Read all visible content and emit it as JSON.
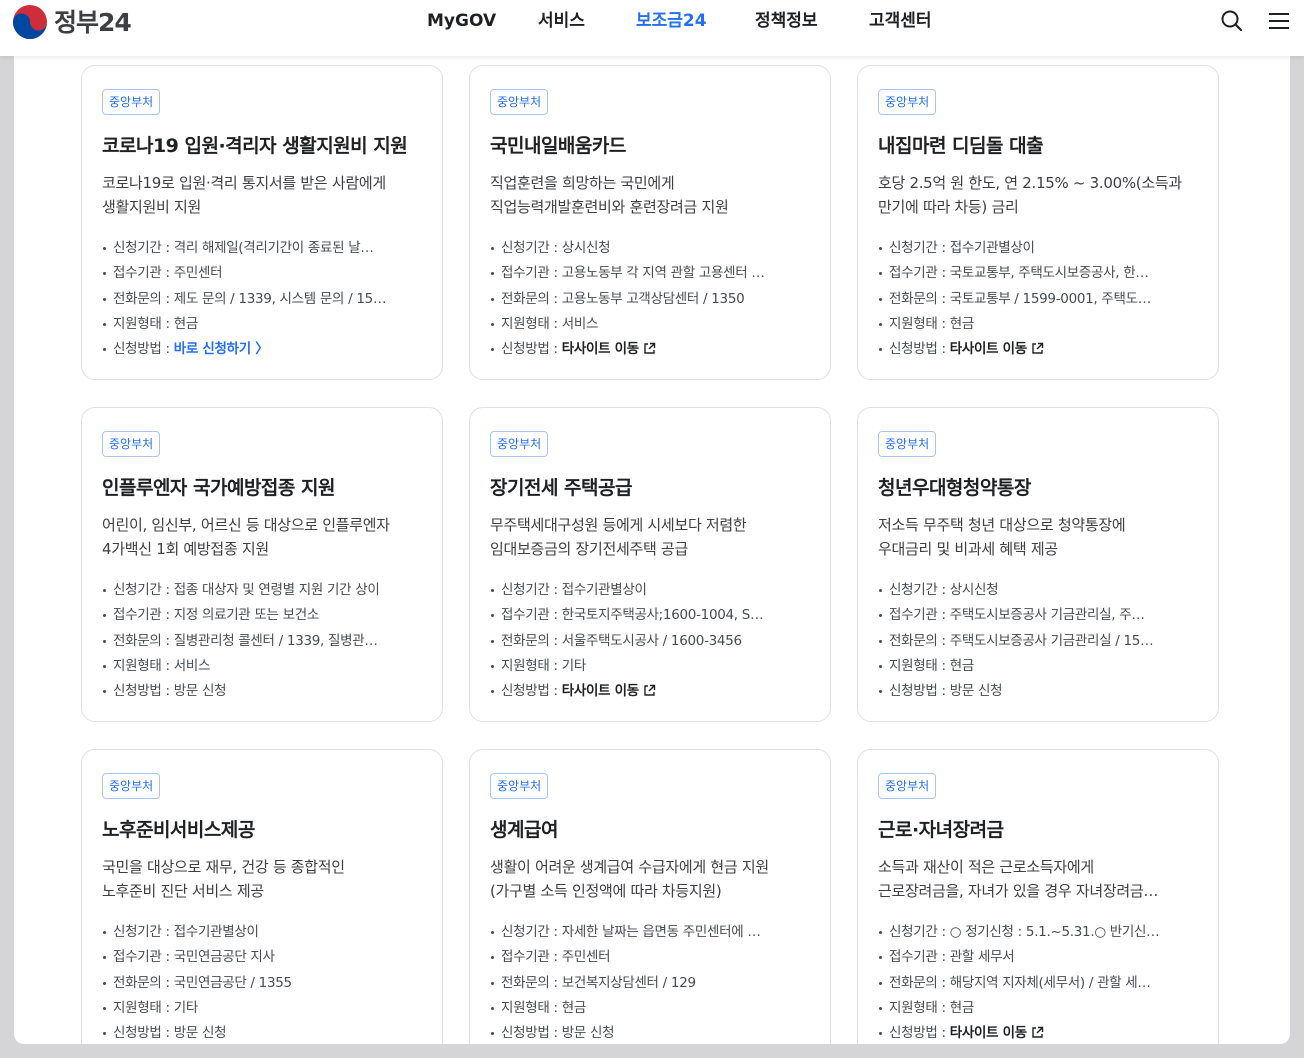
{
  "logo": {
    "text": "정부24"
  },
  "nav": {
    "items": [
      {
        "label": "MyGOV"
      },
      {
        "label": "서비스"
      },
      {
        "label": "보조금24"
      },
      {
        "label": "정책정보"
      },
      {
        "label": "고객센터"
      }
    ],
    "active": "보조금24"
  },
  "icons": {
    "search": "search-icon",
    "menu": "menu-icon",
    "external": "external-link-icon"
  },
  "colors": {
    "accent": "#256ef4",
    "badge_border": "#a9c4f3",
    "card_border": "#dfe1e6"
  },
  "labels": {
    "period": "신청기간 : ",
    "agency": "접수기관 : ",
    "phone": "전화문의 : ",
    "type": "지원형태 : ",
    "method": "신청방법 : "
  },
  "cards": [
    {
      "badge": "중앙부처",
      "title": "코로나19 입원·격리자 생활지원비 지원",
      "desc": [
        "코로나19로 입원·격리 통지서를 받은 사람에게",
        "생활지원비 지원"
      ],
      "period": "격리 해제일(격리기간이 종료된 날…",
      "agency": "주민센터",
      "phone": "제도 문의 / 1339, 시스템 문의 / 15…",
      "type": "현금",
      "method": "바로 신청하기 〉"
    },
    {
      "badge": "중앙부처",
      "title": "국민내일배움카드",
      "desc": [
        "직업훈련을 희망하는 국민에게",
        "직업능력개발훈련비와 훈련장려금 지원"
      ],
      "period": "상시신청",
      "agency": "고용노동부 각 지역 관할 고용센터 …",
      "phone": "고용노동부 고객상담센터 / 1350",
      "type": "서비스",
      "method": "타사이트 이동"
    },
    {
      "badge": "중앙부처",
      "title": "내집마련 디딤돌 대출",
      "desc": [
        "호당 2.5억 원 한도, 연 2.15% ~ 3.00%(소득과",
        "만기에 따라 차등) 금리"
      ],
      "period": "접수기관별상이",
      "agency": "국토교통부, 주택도시보증공사, 한…",
      "phone": "국토교통부 / 1599-0001, 주택도…",
      "type": "현금",
      "method": "타사이트 이동"
    },
    {
      "badge": "중앙부처",
      "title": "인플루엔자 국가예방접종 지원",
      "desc": [
        "어린이, 임신부, 어르신 등 대상으로 인플루엔자",
        "4가백신 1회 예방접종 지원"
      ],
      "period": "접종 대상자 및 연령별 지원 기간 상이",
      "agency": "지정 의료기관 또는 보건소",
      "phone": "질병관리청 콜센터 / 1339, 질병관…",
      "type": "서비스",
      "method": "방문 신청"
    },
    {
      "badge": "중앙부처",
      "title": "장기전세 주택공급",
      "desc": [
        "무주택세대구성원 등에게 시세보다 저렴한",
        "임대보증금의 장기전세주택 공급"
      ],
      "period": "접수기관별상이",
      "agency": "한국토지주택공사;1600-1004, S…",
      "phone": "서울주택도시공사 / 1600-3456",
      "type": "기타",
      "method": "타사이트 이동"
    },
    {
      "badge": "중앙부처",
      "title": "청년우대형청약통장",
      "desc": [
        "저소득 무주택 청년 대상으로 청약통장에",
        "우대금리 및 비과세 혜택 제공"
      ],
      "period": "상시신청",
      "agency": "주택도시보증공사 기금관리실, 주…",
      "phone": "주택도시보증공사 기금관리실 / 15…",
      "type": "현금",
      "method": "방문 신청"
    },
    {
      "badge": "중앙부처",
      "title": "노후준비서비스제공",
      "desc": [
        "국민을 대상으로 재무, 건강 등 종합적인",
        "노후준비 진단 서비스 제공"
      ],
      "period": "접수기관별상이",
      "agency": "국민연금공단 지사",
      "phone": "국민연금공단 / 1355",
      "type": "기타",
      "method": "방문 신청"
    },
    {
      "badge": "중앙부처",
      "title": "생계급여",
      "desc": [
        "생활이 어려운 생계급여 수급자에게 현금 지원",
        "(가구별 소득 인정액에 따라 차등지원)"
      ],
      "period": "자세한 날짜는 읍면동 주민센터에 …",
      "agency": "주민센터",
      "phone": "보건복지상담센터 / 129",
      "type": "현금",
      "method": "방문 신청"
    },
    {
      "badge": "중앙부처",
      "title": "근로·자녀장려금",
      "desc": [
        "소득과 재산이 적은 근로소득자에게",
        "근로장려금을, 자녀가 있을 경우 자녀장려금…"
      ],
      "period": "○ 정기신청 : 5.1.~5.31.○ 반기신…",
      "agency": "관할 세무서",
      "phone": "해당지역 지자체(세무서) / 관할 세…",
      "type": "현금",
      "method": "타사이트 이동"
    }
  ]
}
